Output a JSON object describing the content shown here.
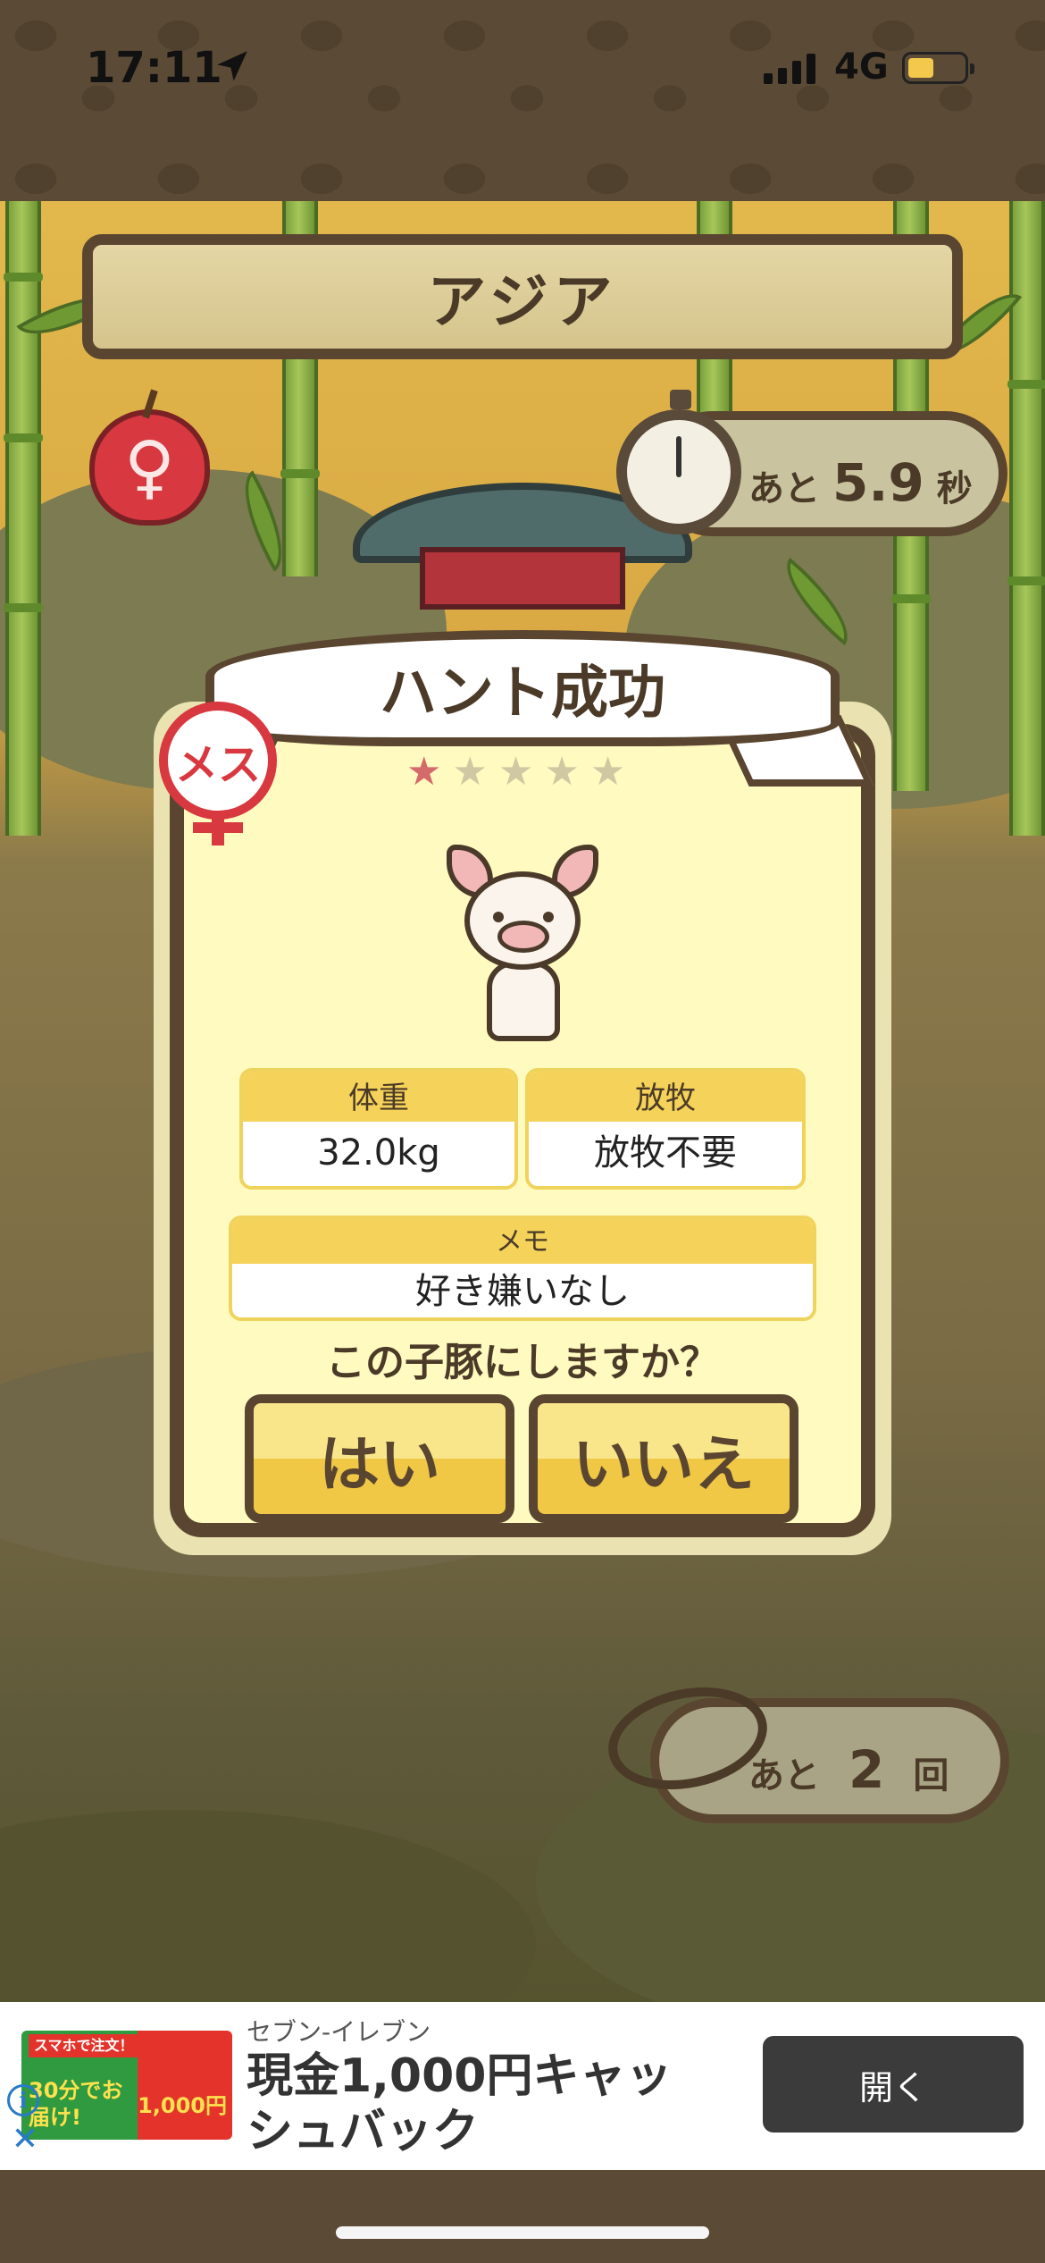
{
  "status_bar": {
    "time": "17:11",
    "network": "4G",
    "battery_level": 0.45,
    "location_icon": "location-arrow-icon"
  },
  "header": {
    "region_title": "アジア"
  },
  "gender_indicator": {
    "glyph": "♀",
    "icon": "female-apple-icon"
  },
  "timer": {
    "prefix": "あと",
    "value": "5.9",
    "unit": "秒",
    "icon": "stopwatch-icon"
  },
  "result_dialog": {
    "title": "ハント成功",
    "gender_badge": "メス",
    "rating": {
      "filled": 1,
      "total": 5,
      "glyph": "★"
    },
    "pig_icon": "piglet-icon",
    "weight": {
      "label": "体重",
      "value": "32.0kg"
    },
    "grazing": {
      "label": "放牧",
      "value": "放牧不要"
    },
    "memo": {
      "label": "メモ",
      "value": "好き嫌いなし"
    },
    "question": "この子豚にしますか？",
    "yes_label": "はい",
    "no_label": "いいえ"
  },
  "remaining_tries": {
    "prefix": "あと",
    "value": "2",
    "unit": "回",
    "icon": "lasso-icon"
  },
  "ad": {
    "image_text_top": "スマホで注文！",
    "image_text_left": "30分でお届け!",
    "image_text_right": "1,000円",
    "brand": "セブン-イレブン",
    "headline": "現金1,000円キャッシュバック",
    "open_label": "開く",
    "info_glyph": "i",
    "close_glyph": "✕"
  },
  "colors": {
    "frame_brown": "#5a4630",
    "dialog_fill": "#fffac0",
    "accent_yellow": "#f5d35a",
    "female_red": "#d8383f"
  }
}
